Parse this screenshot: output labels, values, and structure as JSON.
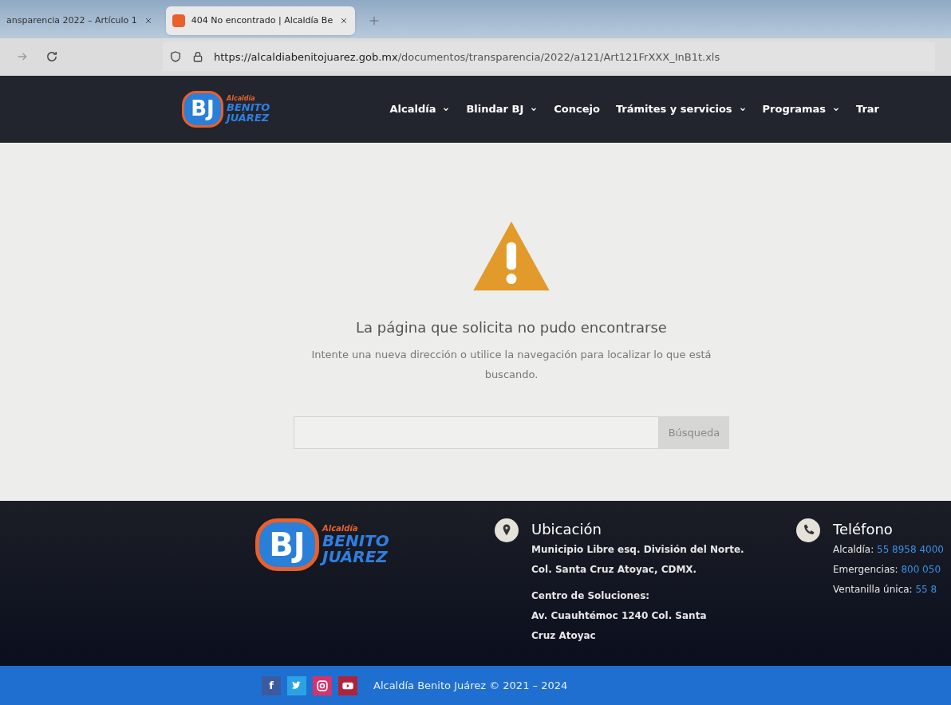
{
  "browser": {
    "tabs": [
      {
        "label": "ansparencia 2022 – Artículo 1",
        "selected": false,
        "has_favicon": false
      },
      {
        "label": "404 No encontrado | Alcaldía Be",
        "selected": true,
        "has_favicon": true
      }
    ],
    "url": {
      "host": "https://alcaldiabenitojuarez.gob.mx",
      "path": "/documentos/transparencia/2022/a121/Art121FrXXX_InB1t.xls"
    }
  },
  "header": {
    "logo": {
      "monogram": "BJ",
      "small": "Alcaldía",
      "line1": "BENITO",
      "line2": "JUÁREZ"
    },
    "nav": [
      {
        "label": "Alcaldía",
        "dropdown": true
      },
      {
        "label": "Blindar BJ",
        "dropdown": true
      },
      {
        "label": "Concejo",
        "dropdown": false
      },
      {
        "label": "Trámites y servicios",
        "dropdown": true
      },
      {
        "label": "Programas",
        "dropdown": true
      },
      {
        "label": "Trar",
        "dropdown": false
      }
    ]
  },
  "error": {
    "title": "La página que solicita no pudo encontrarse",
    "message": "Intente una nueva dirección o utilice la navegación para localizar lo que está buscando.",
    "search_button": "Búsqueda"
  },
  "footer": {
    "logo": {
      "monogram": "BJ",
      "small": "Alcaldía",
      "line1": "BENITO",
      "line2": "JUÁREZ"
    },
    "location": {
      "title": "Ubicación",
      "lines": [
        "Municipio Libre esq. División del Norte.",
        "Col. Santa Cruz Atoyac, CDMX."
      ],
      "lines2": [
        "Centro de Soluciones:",
        "Av. Cuauhtémoc 1240 Col. Santa Cruz Atoyac"
      ]
    },
    "phone": {
      "title": "Teléfono",
      "entries": [
        {
          "label": "Alcaldía:",
          "number": "55 8958 4000"
        },
        {
          "label": "Emergencias:",
          "number": "800 050"
        },
        {
          "label": "Ventanilla única:",
          "number": "55 8"
        }
      ]
    },
    "social": [
      {
        "kind": "facebook",
        "glyph": "f"
      },
      {
        "kind": "twitter"
      },
      {
        "kind": "instagram"
      },
      {
        "kind": "youtube"
      }
    ],
    "copyright": "Alcaldía Benito Juárez © 2021 – 2024"
  }
}
